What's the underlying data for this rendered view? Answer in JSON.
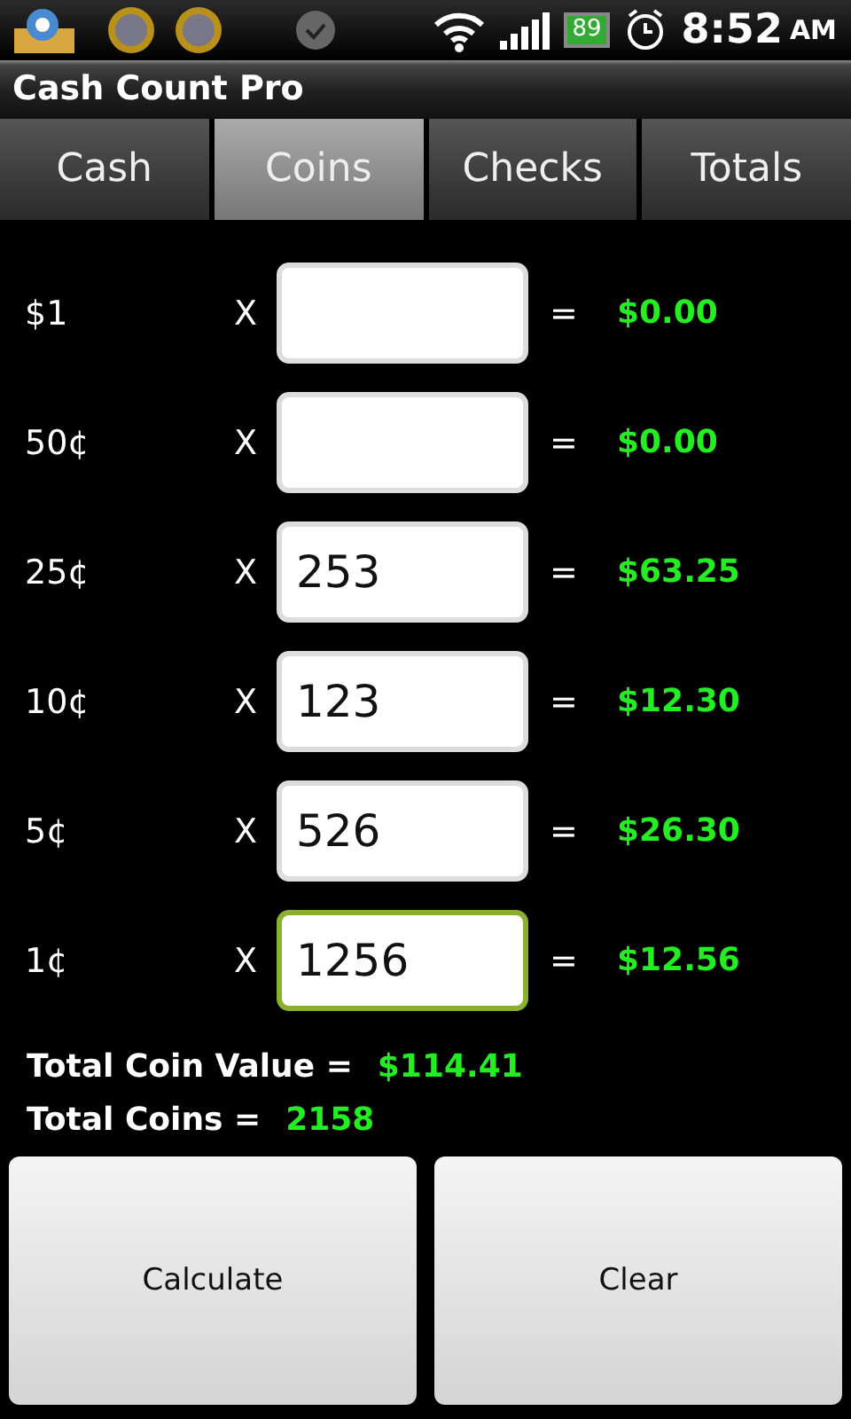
{
  "status_bar": {
    "battery": "89",
    "time": "8:52",
    "meridiem": "AM"
  },
  "title": "Cash Count Pro",
  "tabs": [
    {
      "label": "Cash",
      "selected": false
    },
    {
      "label": "Coins",
      "selected": true
    },
    {
      "label": "Checks",
      "selected": false
    },
    {
      "label": "Totals",
      "selected": false
    }
  ],
  "rows": [
    {
      "denomination": "$1",
      "times": "X",
      "value": "",
      "equals": "=",
      "result": "$0.00",
      "focused": false
    },
    {
      "denomination": "50¢",
      "times": "X",
      "value": "",
      "equals": "=",
      "result": "$0.00",
      "focused": false
    },
    {
      "denomination": "25¢",
      "times": "X",
      "value": "253",
      "equals": "=",
      "result": "$63.25",
      "focused": false
    },
    {
      "denomination": "10¢",
      "times": "X",
      "value": "123",
      "equals": "=",
      "result": "$12.30",
      "focused": false
    },
    {
      "denomination": "5¢",
      "times": "X",
      "value": "526",
      "equals": "=",
      "result": "$26.30",
      "focused": false
    },
    {
      "denomination": "1¢",
      "times": "X",
      "value": "1256",
      "equals": "=",
      "result": "$12.56",
      "focused": true
    }
  ],
  "totals": [
    {
      "label": "Total Coin Value =",
      "value": "$114.41"
    },
    {
      "label": "Total Coins =",
      "value": "2158"
    }
  ],
  "buttons": [
    "Calculate",
    "Clear"
  ]
}
